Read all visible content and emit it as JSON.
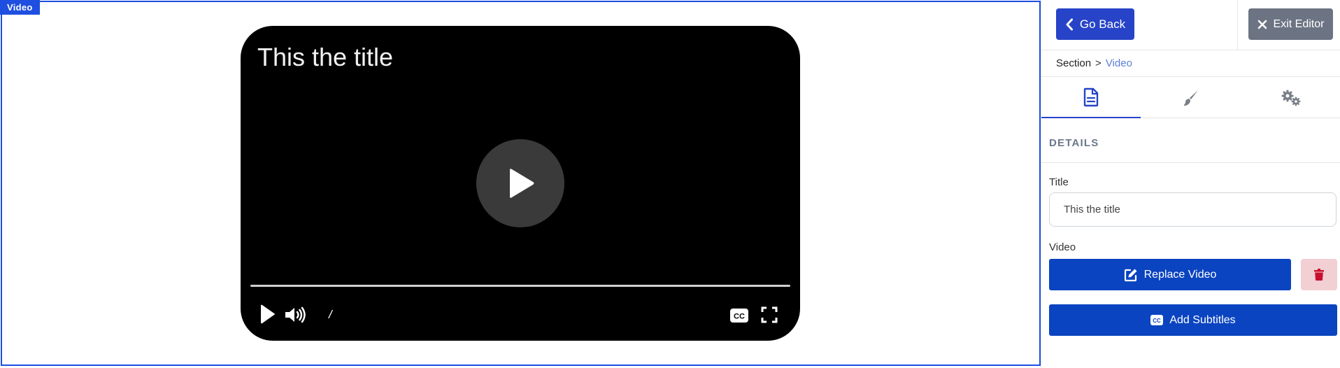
{
  "canvas": {
    "section_tag": "Video",
    "player": {
      "title": "This the title",
      "time_separator": "/",
      "progress_fraction": 0
    }
  },
  "sidebar": {
    "go_back_label": "Go Back",
    "exit_editor_label": "Exit Editor",
    "breadcrumb": {
      "parent": "Section",
      "separator": ">",
      "current": "Video"
    },
    "tabs": [
      {
        "icon": "document-icon",
        "active": true
      },
      {
        "icon": "brush-icon",
        "active": false
      },
      {
        "icon": "gears-icon",
        "active": false
      }
    ],
    "details_heading": "DETAILS",
    "title_field": {
      "label": "Title",
      "value": "This the title"
    },
    "video_field": {
      "label": "Video",
      "replace_label": "Replace Video",
      "delete_icon": "trash-icon"
    },
    "add_subtitles_label": "Add Subtitles"
  },
  "colors": {
    "accent": "#1f4fe0",
    "primary_button": "#0b44c0",
    "go_back_button": "#2744c8",
    "exit_button": "#6c7483",
    "danger_bg": "#f1cfd3",
    "danger_icon": "#c8102e",
    "breadcrumb_current": "#5a7fd6"
  }
}
